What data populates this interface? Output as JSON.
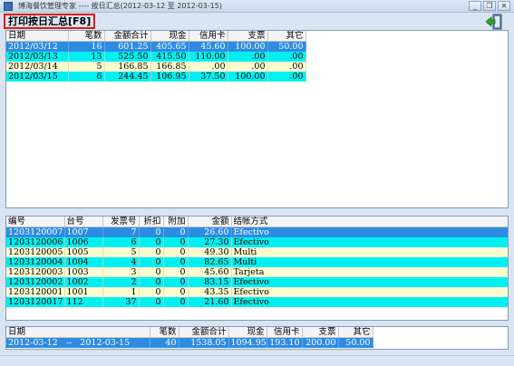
{
  "window": {
    "title": "博海餐饮管理专家 ---- 按日汇总(2012-03-12 至 2012-03-15)",
    "minimize_glyph": "_",
    "restore_glyph": "❐",
    "close_glyph": "✕"
  },
  "page_title": "打印按日汇总[F8]",
  "accent_color": "#e01818",
  "selected_row_color": "#2d8be2",
  "alt_row_color": "#00f0f2",
  "daily": {
    "columns": [
      "日期",
      "笔数",
      "金额合计",
      "现金",
      "信用卡",
      "支票",
      "其它"
    ],
    "rows": [
      [
        "2012/03/12",
        "16",
        "601.25",
        "405.65",
        "45.60",
        "100.00",
        "50.00"
      ],
      [
        "2012/03/13",
        "13",
        "525.50",
        "415.50",
        "110.00",
        ".00",
        ".00"
      ],
      [
        "2012/03/14",
        "5",
        "166.85",
        "166.85",
        ".00",
        ".00",
        ".00"
      ],
      [
        "2012/03/15",
        "6",
        "244.45",
        "106.95",
        "37.50",
        "100.00",
        ".00"
      ]
    ]
  },
  "bills": {
    "columns": [
      "编号",
      "台号",
      "发票号",
      "折扣",
      "附加",
      "金额",
      "结帐方式"
    ],
    "rows": [
      [
        "1203120007",
        "1007",
        "7",
        "0",
        "0",
        "26.60",
        "Efectivo"
      ],
      [
        "1203120006",
        "1006",
        "6",
        "0",
        "0",
        "27.30",
        "Efectivo"
      ],
      [
        "1203120005",
        "1005",
        "5",
        "0",
        "0",
        "49.30",
        "Multi"
      ],
      [
        "1203120004",
        "1004",
        "4",
        "0",
        "0",
        "82.65",
        "Multi"
      ],
      [
        "1203120003",
        "1003",
        "3",
        "0",
        "0",
        "45.60",
        "Tarjeta"
      ],
      [
        "1203120002",
        "1002",
        "2",
        "0",
        "0",
        "83.15",
        "Efectivo"
      ],
      [
        "1203120001",
        "1001",
        "1",
        "0",
        "0",
        "43.35",
        "Efectivo"
      ],
      [
        "1203120017",
        "112",
        "37",
        "0",
        "0",
        "21.60",
        "Efectivo"
      ]
    ]
  },
  "total": {
    "columns": [
      "日期",
      "笔数",
      "金额合计",
      "现金",
      "信用卡",
      "支票",
      "其它"
    ],
    "row": [
      "2012-03-12   --   2012-03-15",
      "40",
      "1538.05",
      "1094.95",
      "193.10",
      "200.00",
      "50.00"
    ]
  }
}
